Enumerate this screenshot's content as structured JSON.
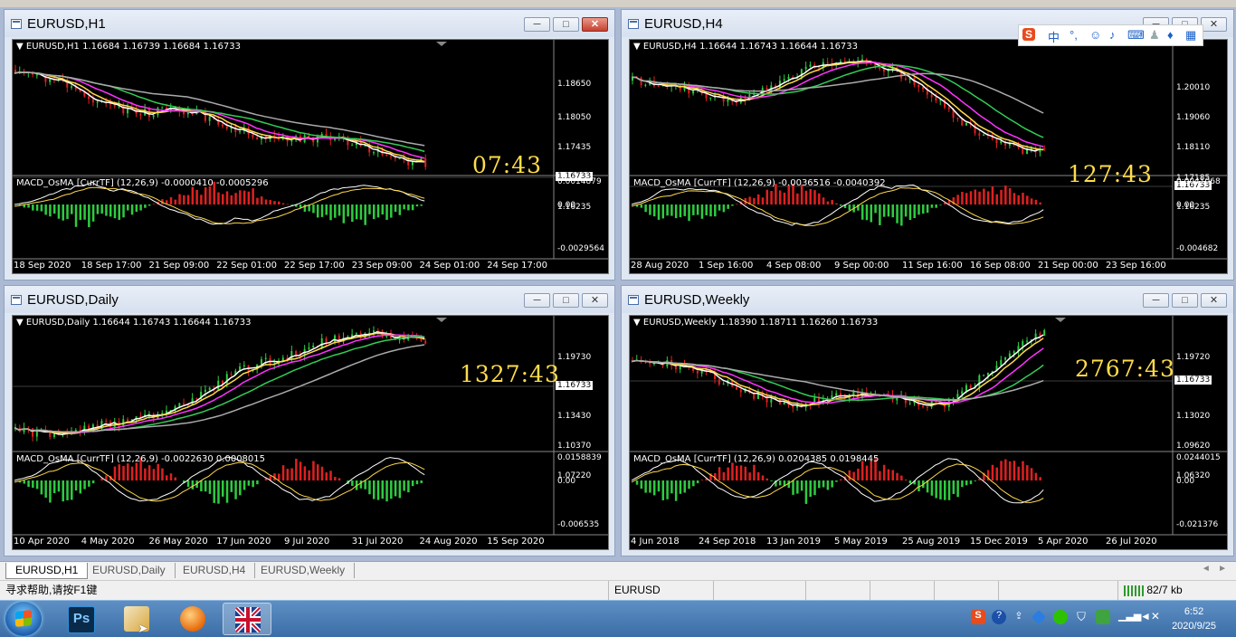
{
  "windows": [
    {
      "key": "h1",
      "title": "EURUSD,H1",
      "header": "EURUSD,H1  1.16684 1.16739 1.16684 1.16733",
      "prices": [
        "1.18650",
        "1.18050",
        "1.17435",
        "1.16835",
        "1.16235"
      ],
      "current_price": "1.16733",
      "timer": "07:43",
      "macd_label": "MACD_OsMA [CurrTF] (12,26,9) -0.0000410 -0.0005296",
      "macd_scale": [
        "0.0014879",
        "0.00",
        "-0.0029564"
      ],
      "dates": [
        "18 Sep 2020",
        "18 Sep 17:00",
        "21 Sep 09:00",
        "22 Sep 01:00",
        "22 Sep 17:00",
        "23 Sep 09:00",
        "24 Sep 01:00",
        "24 Sep 17:00"
      ]
    },
    {
      "key": "h4",
      "title": "EURUSD,H4",
      "header": "EURUSD,H4  1.16644 1.16743 1.16644 1.16733",
      "prices": [
        "1.20010",
        "1.19060",
        "1.18110",
        "1.17185",
        "1.16235"
      ],
      "current_price": "1.16733",
      "timer": "127:43",
      "macd_label": "MACD_OsMA [CurrTF] (12,26,9) -0.0036516 -0.0040392",
      "macd_scale": [
        "0.0041068",
        "0.00",
        "-0.004682"
      ],
      "dates": [
        "28 Aug 2020",
        "1 Sep 16:00",
        "4 Sep 08:00",
        "9 Sep 00:00",
        "11 Sep 16:00",
        "16 Sep 08:00",
        "21 Sep 00:00",
        "23 Sep 16:00"
      ]
    },
    {
      "key": "daily",
      "title": "EURUSD,Daily",
      "header": "EURUSD,Daily  1.16644 1.16743 1.16644 1.16733",
      "prices": [
        "1.19730",
        "1.16733",
        "1.13430",
        "1.10370",
        "1.07220"
      ],
      "current_price": "1.16733",
      "timer": "1327:43",
      "macd_label": "MACD_OsMA [CurrTF] (12,26,9) -0.0022630 0.0008015",
      "macd_scale": [
        "0.0158839",
        "0.00",
        "-0.006535"
      ],
      "dates": [
        "10 Apr 2020",
        "4 May 2020",
        "26 May 2020",
        "17 Jun 2020",
        "9 Jul 2020",
        "31 Jul 2020",
        "24 Aug 2020",
        "15 Sep 2020"
      ]
    },
    {
      "key": "weekly",
      "title": "EURUSD,Weekly",
      "header": "EURUSD,Weekly  1.18390 1.18711 1.16260 1.16733",
      "prices": [
        "1.19720",
        "1.16733",
        "1.13020",
        "1.09620",
        "1.06320"
      ],
      "current_price": "1.16733",
      "timer": "2767:43",
      "macd_label": "MACD_OsMA [CurrTF] (12,26,9) 0.0204385 0.0198445",
      "macd_scale": [
        "0.0244015",
        "0.00",
        "-0.021376"
      ],
      "dates": [
        "4 Jun 2018",
        "24 Sep 2018",
        "13 Jan 2019",
        "5 May 2019",
        "25 Aug 2019",
        "15 Dec 2019",
        "5 Apr 2020",
        "26 Jul 2020"
      ]
    }
  ],
  "tabs": [
    "EURUSD,H1",
    "EURUSD,Daily",
    "EURUSD,H4",
    "EURUSD,Weekly"
  ],
  "active_tab": "EURUSD,H1",
  "status": {
    "help": "寻求帮助,请按F1键",
    "profile": "EURUSD",
    "traffic": "82/7 kb"
  },
  "clock": {
    "time": "6:52",
    "date": "2020/9/25"
  },
  "ime": {
    "mode": "中"
  },
  "colors": {
    "bull": "#2ecc40",
    "bear": "#e02020",
    "ma_fast": "#ffffff",
    "ma_yellow": "#ffd84a",
    "ma_magenta": "#ff33ff",
    "ma_green": "#33cc55",
    "ma_gray": "#aaaaaa",
    "timer": "#ffdc4a"
  }
}
